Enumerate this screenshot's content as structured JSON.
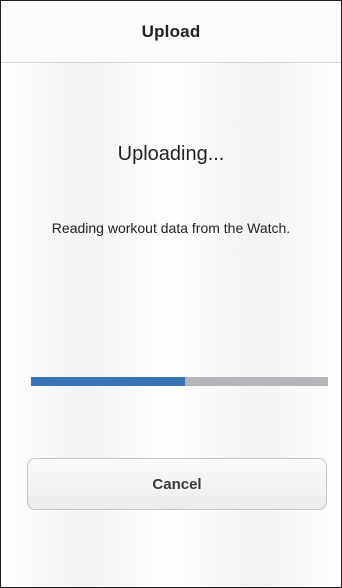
{
  "header": {
    "title": "Upload"
  },
  "status": {
    "heading": "Uploading...",
    "message": "Reading workout data from the Watch."
  },
  "progress": {
    "fraction": 0.52,
    "fill_color": "#3b73b7",
    "track_color": "#b4b5b9"
  },
  "actions": {
    "cancel_label": "Cancel"
  }
}
